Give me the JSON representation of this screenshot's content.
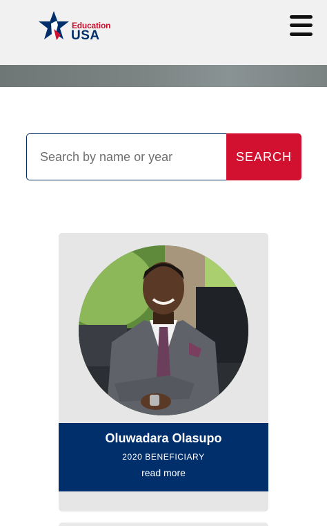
{
  "header": {
    "logo": {
      "line1": "Education",
      "line2": "USA",
      "icon": "star-logo-icon"
    },
    "menu": {
      "icon": "hamburger-menu-icon"
    }
  },
  "search": {
    "placeholder": "Search by name or year",
    "value": "",
    "button_label": "SEARCH"
  },
  "cards": [
    {
      "name": "Oluwadara Olasupo",
      "subtitle": "2020 BENEFICIARY",
      "link": "read more",
      "photo": "profile-photo"
    }
  ],
  "colors": {
    "brand_navy": "#002f6c",
    "brand_red": "#d2102f",
    "header_bg": "#f1f1f1",
    "card_bg": "#e6e6e6"
  }
}
